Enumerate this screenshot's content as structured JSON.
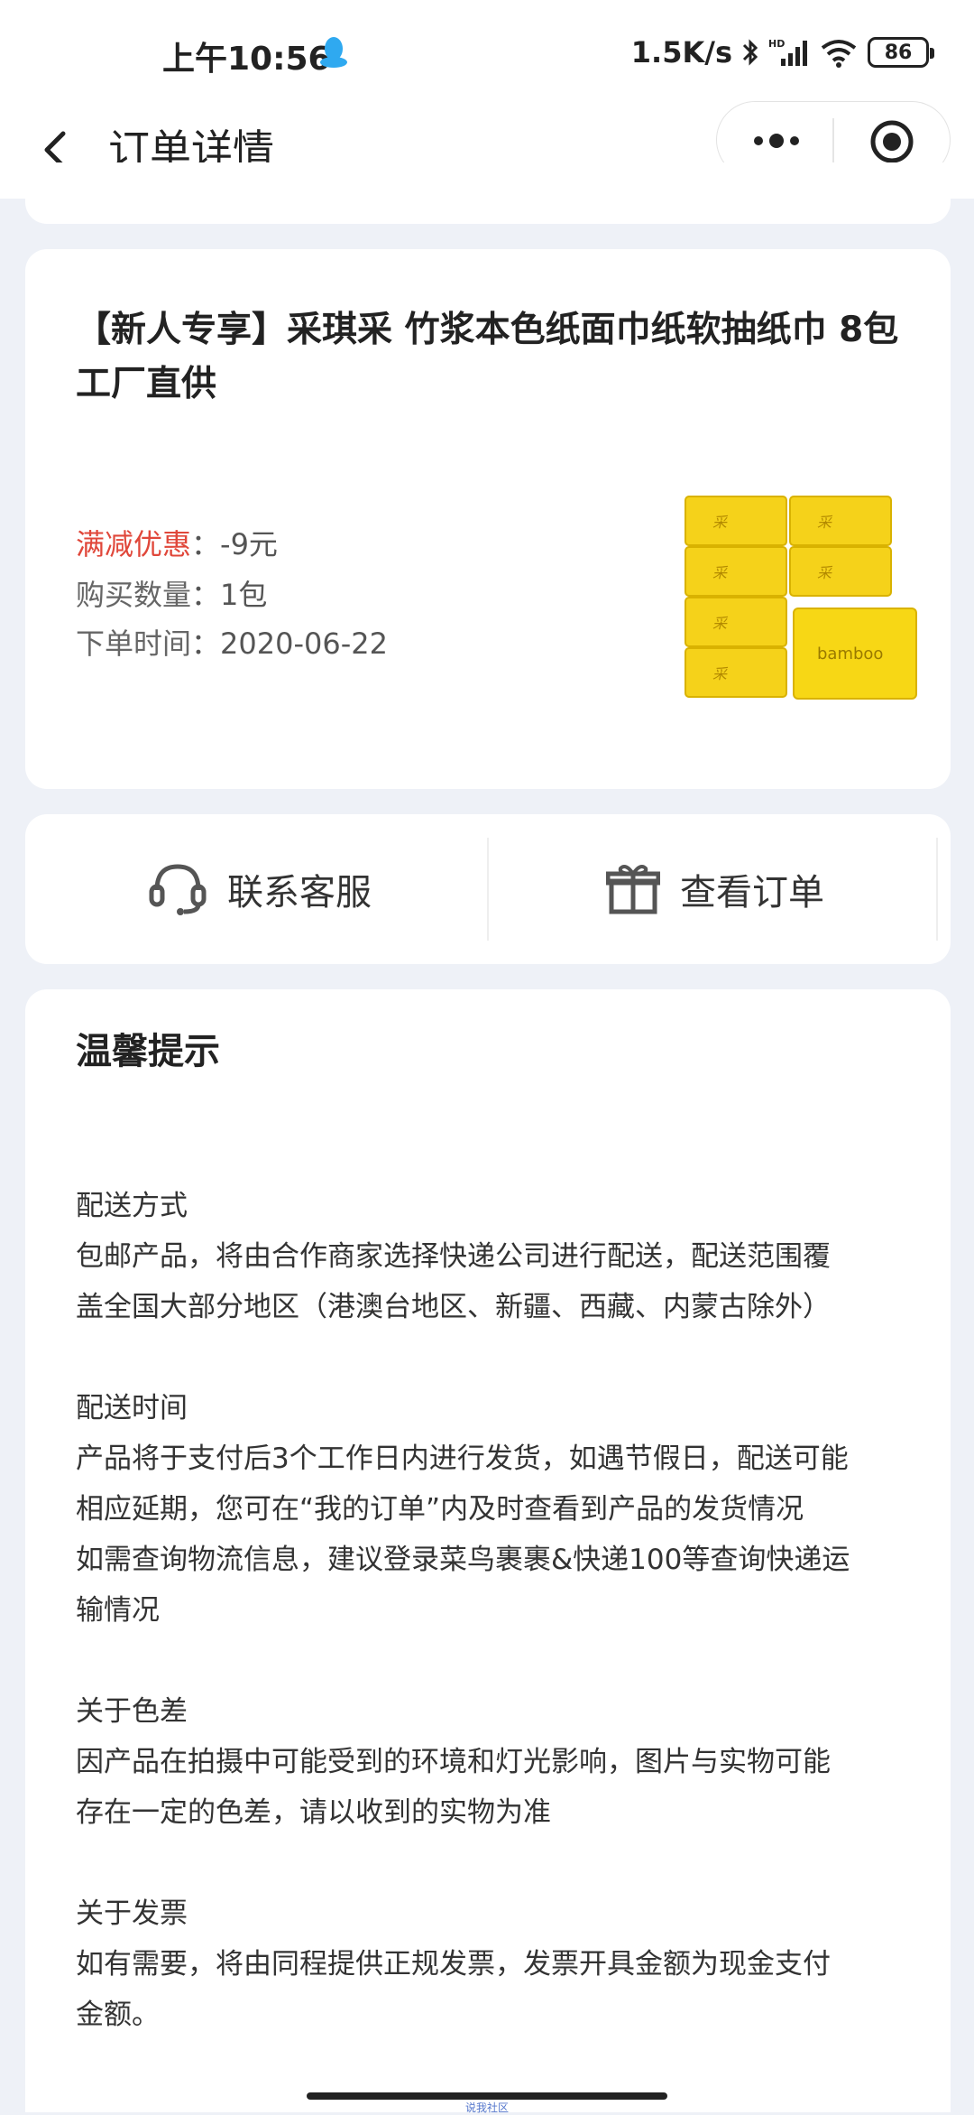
{
  "status_bar": {
    "time": "上午10:56",
    "network_speed": "1.5K/s",
    "battery": "86"
  },
  "nav": {
    "title": "订单详情"
  },
  "product": {
    "title": "【新人专享】采琪采 竹浆本色纸面巾纸软抽纸巾 8包 工厂直供",
    "discount_label": "满减优惠",
    "discount_value": "：-9元",
    "quantity_label": "购买数量",
    "quantity_value": "：1包",
    "order_time_label": "下单时间",
    "order_time_value": "：2020-06-22",
    "image_brand": "bamboo"
  },
  "actions": {
    "contact_label": "联系客服",
    "view_order_label": "查看订单"
  },
  "tips": {
    "title": "温馨提示",
    "sections": [
      {
        "heading": "配送方式",
        "lines": [
          "包邮产品，将由合作商家选择快递公司进行配送，配送范围覆",
          "盖全国大部分地区（港澳台地区、新疆、西藏、内蒙古除外）"
        ]
      },
      {
        "heading": "配送时间",
        "lines": [
          "产品将于支付后3个工作日内进行发货，如遇节假日，配送可能",
          "相应延期，您可在“我的订单”内及时查看到产品的发货情况",
          "如需查询物流信息，建议登录菜鸟裹裹&快递100等查询快递运",
          "输情况"
        ]
      },
      {
        "heading": "关于色差",
        "lines": [
          "因产品在拍摄中可能受到的环境和灯光影响，图片与实物可能",
          "存在一定的色差，请以收到的实物为准"
        ]
      },
      {
        "heading": "关于发票",
        "lines": [
          "如有需要，将由同程提供正规发票，发票开具金额为现金支付",
          "金额。"
        ]
      }
    ]
  },
  "watermark": "说我社区",
  "colors": {
    "background": "#eef1f7",
    "discount_red": "#e0473a",
    "product_yellow": "#f5d21a"
  }
}
